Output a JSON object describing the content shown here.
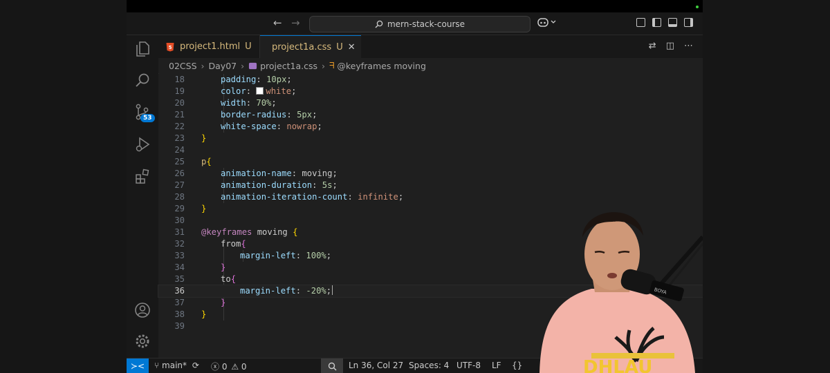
{
  "window": {
    "search_label": "mern-stack-course"
  },
  "tabs": [
    {
      "label": "project1.html",
      "status": "U",
      "icon": "html-file-icon"
    },
    {
      "label": "project1a.css",
      "status": "U",
      "icon": "css-file-icon",
      "active": true
    }
  ],
  "breadcrumb": {
    "folder1": "02CSS",
    "folder2": "Day07",
    "file": "project1a.css",
    "symbol": "@keyframes moving"
  },
  "activity": {
    "scm_badge": "53"
  },
  "editor": {
    "lines": [
      {
        "num": "18",
        "text": "padding: 10px;"
      },
      {
        "num": "19",
        "text": "color: white;"
      },
      {
        "num": "20",
        "text": "width: 70%;"
      },
      {
        "num": "21",
        "text": "border-radius: 5px;"
      },
      {
        "num": "22",
        "text": "white-space: nowrap;"
      },
      {
        "num": "23",
        "text": "}"
      },
      {
        "num": "24",
        "text": ""
      },
      {
        "num": "25",
        "text": "p{"
      },
      {
        "num": "26",
        "text": "animation-name: moving;"
      },
      {
        "num": "27",
        "text": "animation-duration: 5s;"
      },
      {
        "num": "28",
        "text": "animation-iteration-count: infinite;"
      },
      {
        "num": "29",
        "text": "}"
      },
      {
        "num": "30",
        "text": ""
      },
      {
        "num": "31",
        "text": "@keyframes moving {"
      },
      {
        "num": "32",
        "text": "from{"
      },
      {
        "num": "33",
        "text": "margin-left: 100%;"
      },
      {
        "num": "34",
        "text": "}"
      },
      {
        "num": "35",
        "text": "to{"
      },
      {
        "num": "36",
        "text": "margin-left: -20%;"
      },
      {
        "num": "37",
        "text": "}"
      },
      {
        "num": "38",
        "text": "}"
      },
      {
        "num": "39",
        "text": ""
      }
    ],
    "current_line": "36"
  },
  "statusbar": {
    "branch": "main*",
    "errors": "0",
    "warnings": "0",
    "position": "Ln 36, Col 27",
    "spaces": "Spaces: 4",
    "encoding": "UTF-8",
    "eol": "LF",
    "language_icon": "{}"
  },
  "presenter": {
    "shirt_text": "DHLAU"
  },
  "colors": {
    "property": "#9cdcfe",
    "value": "#ce9178",
    "number": "#b5cea8",
    "keyword": "#c586c0",
    "bracket_yellow": "#ffd700",
    "bracket_purple": "#da70d6",
    "accent": "#0078d4",
    "modified": "#d7ba7d"
  }
}
